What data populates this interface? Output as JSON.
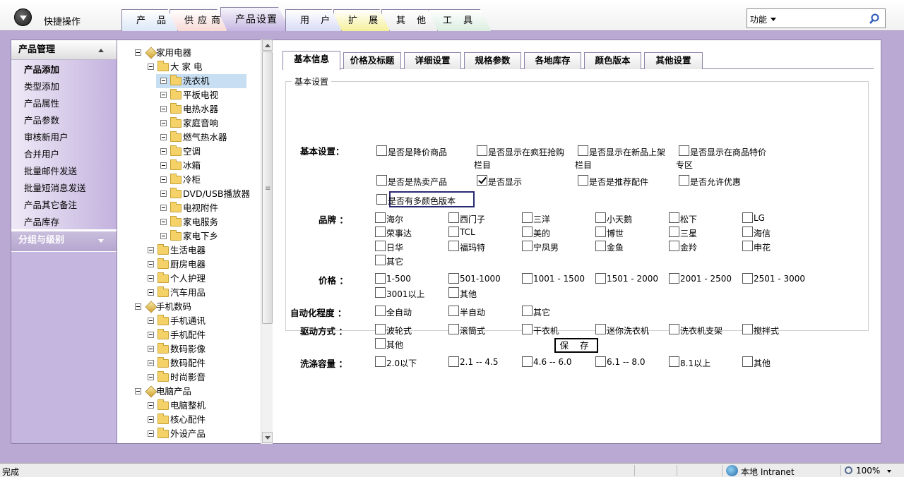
{
  "header": {
    "quick_label": "快捷操作"
  },
  "nav_tabs": [
    {
      "label": "产 品",
      "color": "#dce7f7"
    },
    {
      "label": "供应商",
      "color": "#f7d9d5"
    },
    {
      "label": "产品设置",
      "color": "#c5b6e2",
      "active": true
    },
    {
      "label": "用 户",
      "color": "#d8dcf6"
    },
    {
      "label": "扩 展",
      "color": "#f5f09a"
    },
    {
      "label": "其 他",
      "color": "#ededed"
    },
    {
      "label": "工 具",
      "color": "#dbeee0"
    }
  ],
  "search": {
    "select_label": "功能",
    "placeholder": ""
  },
  "sidebar": {
    "section_title": "产品管理",
    "items": [
      "产品添加",
      "类型添加",
      "产品属性",
      "产品参数",
      "审核新用户",
      "合并用户",
      "批量邮件发送",
      "批量短消息发送",
      "产品其它备注",
      "产品库存"
    ],
    "group_title": "分组与级别"
  },
  "tree": [
    {
      "label": "家用电器",
      "level": 0,
      "icon": "cube",
      "exp": "minus"
    },
    {
      "label": "大 家 电",
      "level": 1,
      "icon": "folder",
      "exp": "minus"
    },
    {
      "label": "洗衣机",
      "level": 2,
      "icon": "folder",
      "exp": "minus",
      "selected": true
    },
    {
      "label": "平板电视",
      "level": 2,
      "icon": "folder",
      "exp": "minus"
    },
    {
      "label": "电热水器",
      "level": 2,
      "icon": "folder",
      "exp": "minus"
    },
    {
      "label": "家庭音响",
      "level": 2,
      "icon": "folder",
      "exp": "minus"
    },
    {
      "label": "燃气热水器",
      "level": 2,
      "icon": "folder",
      "exp": "minus"
    },
    {
      "label": "空调",
      "level": 2,
      "icon": "folder",
      "exp": "minus"
    },
    {
      "label": "冰箱",
      "level": 2,
      "icon": "folder",
      "exp": "minus"
    },
    {
      "label": "冷柜",
      "level": 2,
      "icon": "folder",
      "exp": "minus"
    },
    {
      "label": "DVD/USB播放器",
      "level": 2,
      "icon": "folder",
      "exp": "minus"
    },
    {
      "label": "电视附件",
      "level": 2,
      "icon": "folder",
      "exp": "minus"
    },
    {
      "label": "家电服务",
      "level": 2,
      "icon": "folder",
      "exp": "minus"
    },
    {
      "label": "家电下乡",
      "level": 2,
      "icon": "folder",
      "exp": "minus"
    },
    {
      "label": "生活电器",
      "level": 1,
      "icon": "folder",
      "exp": "minus"
    },
    {
      "label": "厨房电器",
      "level": 1,
      "icon": "folder",
      "exp": "minus"
    },
    {
      "label": "个人护理",
      "level": 1,
      "icon": "folder",
      "exp": "minus"
    },
    {
      "label": "汽车用品",
      "level": 1,
      "icon": "folder",
      "exp": "minus"
    },
    {
      "label": "手机数码",
      "level": 0,
      "icon": "cube",
      "exp": "minus"
    },
    {
      "label": "手机通讯",
      "level": 1,
      "icon": "folder",
      "exp": "minus"
    },
    {
      "label": "手机配件",
      "level": 1,
      "icon": "folder",
      "exp": "minus"
    },
    {
      "label": "数码影像",
      "level": 1,
      "icon": "folder",
      "exp": "minus"
    },
    {
      "label": "数码配件",
      "level": 1,
      "icon": "folder",
      "exp": "minus"
    },
    {
      "label": "时尚影音",
      "level": 1,
      "icon": "folder",
      "exp": "minus"
    },
    {
      "label": "电脑产品",
      "level": 0,
      "icon": "cube",
      "exp": "minus"
    },
    {
      "label": "电脑整机",
      "level": 1,
      "icon": "folder",
      "exp": "minus"
    },
    {
      "label": "核心配件",
      "level": 1,
      "icon": "folder",
      "exp": "minus"
    },
    {
      "label": "外设产品",
      "level": 1,
      "icon": "folder",
      "exp": "minus"
    }
  ],
  "content_tabs": [
    "基本信息",
    "价格及标题",
    "详细设置",
    "规格参数",
    "各地库存",
    "颜色版本",
    "其他设置"
  ],
  "form": {
    "legend": "基本设置",
    "basic_label": "基本设置：",
    "basic_options": [
      {
        "label": "是否是降价商品",
        "checked": false
      },
      {
        "label": "是否显示在疯狂抢购",
        "label2": "栏目",
        "checked": false
      },
      {
        "label": "是否显示在新品上架",
        "label2": "栏目",
        "checked": false
      },
      {
        "label": "是否显示在商品特价",
        "label2": "专区",
        "checked": false
      },
      {
        "label": "是否是热卖产品",
        "checked": false
      },
      {
        "label": "是否显示",
        "checked": true
      },
      {
        "label": "是否是推荐配件",
        "checked": false
      },
      {
        "label": "是否允许优惠",
        "checked": false
      },
      {
        "label": "是否有多颜色版本",
        "checked": false
      }
    ],
    "brand_label": "品牌 ：",
    "brands": [
      "海尔",
      "西门子",
      "三洋",
      "小天鹅",
      "松下",
      "LG",
      "荣事达",
      "TCL",
      "美的",
      "博世",
      "三星",
      "海信",
      "日华",
      "福玛特",
      "宁凤男",
      "金鱼",
      "金羚",
      "申花",
      "其它"
    ],
    "price_label": "价格 ：",
    "prices": [
      "1-500",
      "501-1000",
      "1001 - 1500",
      "1501 - 2000",
      "2001 - 2500",
      "2501 - 3000",
      "3001以上",
      "其他"
    ],
    "auto_label": "自动化程度 ：",
    "autos": [
      "全自动",
      "半自动",
      "其它"
    ],
    "drive_label": "驱动方式 ：",
    "drives": [
      "波轮式",
      "滚筒式",
      "干衣机",
      "迷你洗衣机",
      "洗衣机支架",
      "搅拌式",
      "其他"
    ],
    "capacity_label": "洗涤容量 ：",
    "capacities": [
      "2.0以下",
      "2.1 -- 4.5",
      "4.6 -- 6.0",
      "6.1 -- 8.0",
      "8.1以上",
      "其他"
    ],
    "save_label": "保 存"
  },
  "status": {
    "text": "完成",
    "zone": "本地 Intranet",
    "zoom": "100%"
  }
}
